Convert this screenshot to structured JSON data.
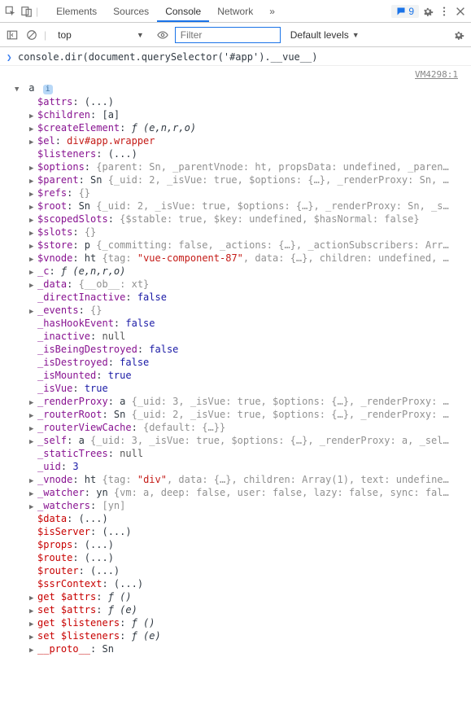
{
  "toolbar": {
    "tabs": [
      "Elements",
      "Sources",
      "Console",
      "Network"
    ],
    "active_tab": "Console",
    "more_tabs": "»",
    "message_count": "9"
  },
  "subbar": {
    "context": "top",
    "filter_placeholder": "Filter",
    "levels_label": "Default levels"
  },
  "command": {
    "text": "console.dir(document.querySelector('#app').__vue__)",
    "source": "VM4298:1"
  },
  "root_label": "a",
  "props": [
    {
      "arrow": "none",
      "key": "$attrs",
      "kc": "k-purple",
      "val": ": (...)"
    },
    {
      "arrow": "right",
      "key": "$children",
      "kc": "k-purple",
      "val": ": [a]"
    },
    {
      "arrow": "right",
      "key": "$createElement",
      "kc": "k-purple",
      "val_html": ": <span class='fn-i'>ƒ (e,n,r,o)</span>"
    },
    {
      "arrow": "right",
      "key": "$el",
      "kc": "k-purple",
      "val_html": ": <span class='v-str'>div#app.wrapper</span>"
    },
    {
      "arrow": "none",
      "key": "$listeners",
      "kc": "k-purple",
      "val": ": (...)"
    },
    {
      "arrow": "right",
      "key": "$options",
      "kc": "k-purple",
      "val_html": ": <span class='v-dim'>{parent: Sn, _parentVnode: ht, propsData: undefined, _paren…</span>"
    },
    {
      "arrow": "right",
      "key": "$parent",
      "kc": "k-purple",
      "val_html": ": Sn <span class='v-dim'>{_uid: 2, _isVue: true, $options: {…}, _renderProxy: Sn, …</span>"
    },
    {
      "arrow": "right",
      "key": "$refs",
      "kc": "k-purple",
      "val_html": ": <span class='v-dim'>{}</span>"
    },
    {
      "arrow": "right",
      "key": "$root",
      "kc": "k-purple",
      "val_html": ": Sn <span class='v-dim'>{_uid: 2, _isVue: true, $options: {…}, _renderProxy: Sn, _s…</span>"
    },
    {
      "arrow": "right",
      "key": "$scopedSlots",
      "kc": "k-purple",
      "val_html": ": <span class='v-dim'>{$stable: true, $key: undefined, $hasNormal: false}</span>"
    },
    {
      "arrow": "right",
      "key": "$slots",
      "kc": "k-purple",
      "val_html": ": <span class='v-dim'>{}</span>"
    },
    {
      "arrow": "right",
      "key": "$store",
      "kc": "k-purple",
      "val_html": ": p <span class='v-dim'>{_committing: false, _actions: {…}, _actionSubscribers: Arr…</span>"
    },
    {
      "arrow": "right",
      "key": "$vnode",
      "kc": "k-purple",
      "val_html": ": ht <span class='v-dim'>{tag: <span class='v-str'>\"vue-component-87\"</span>, data: {…}, children: undefined, …</span>"
    },
    {
      "arrow": "right",
      "key": "_c",
      "kc": "k-purple",
      "val_html": ": <span class='fn-i'>ƒ (e,n,r,o)</span>"
    },
    {
      "arrow": "right",
      "key": "_data",
      "kc": "k-purple",
      "val_html": ": <span class='v-dim'>{__ob__: xt}</span>"
    },
    {
      "arrow": "none",
      "key": "_directInactive",
      "kc": "k-purple",
      "val_html": ": <span class='v-blue'>false</span>"
    },
    {
      "arrow": "right",
      "key": "_events",
      "kc": "k-purple",
      "val_html": ": <span class='v-dim'>{}</span>"
    },
    {
      "arrow": "none",
      "key": "_hasHookEvent",
      "kc": "k-purple",
      "val_html": ": <span class='v-blue'>false</span>"
    },
    {
      "arrow": "none",
      "key": "_inactive",
      "kc": "k-purple",
      "val_html": ": <span class='v-gray'>null</span>"
    },
    {
      "arrow": "none",
      "key": "_isBeingDestroyed",
      "kc": "k-purple",
      "val_html": ": <span class='v-blue'>false</span>"
    },
    {
      "arrow": "none",
      "key": "_isDestroyed",
      "kc": "k-purple",
      "val_html": ": <span class='v-blue'>false</span>"
    },
    {
      "arrow": "none",
      "key": "_isMounted",
      "kc": "k-purple",
      "val_html": ": <span class='v-blue'>true</span>"
    },
    {
      "arrow": "none",
      "key": "_isVue",
      "kc": "k-purple",
      "val_html": ": <span class='v-blue'>true</span>"
    },
    {
      "arrow": "right",
      "key": "_renderProxy",
      "kc": "k-purple",
      "val_html": ": a <span class='v-dim'>{_uid: 3, _isVue: true, $options: {…}, _renderProxy: …</span>"
    },
    {
      "arrow": "right",
      "key": "_routerRoot",
      "kc": "k-purple",
      "val_html": ": Sn <span class='v-dim'>{_uid: 2, _isVue: true, $options: {…}, _renderProxy: …</span>"
    },
    {
      "arrow": "right",
      "key": "_routerViewCache",
      "kc": "k-purple",
      "val_html": ": <span class='v-dim'>{default: {…}}</span>"
    },
    {
      "arrow": "right",
      "key": "_self",
      "kc": "k-purple",
      "val_html": ": a <span class='v-dim'>{_uid: 3, _isVue: true, $options: {…}, _renderProxy: a, _sel…</span>"
    },
    {
      "arrow": "none",
      "key": "_staticTrees",
      "kc": "k-purple",
      "val_html": ": <span class='v-gray'>null</span>"
    },
    {
      "arrow": "none",
      "key": "_uid",
      "kc": "k-purple",
      "val_html": ": <span class='v-blue'>3</span>"
    },
    {
      "arrow": "right",
      "key": "_vnode",
      "kc": "k-purple",
      "val_html": ": ht <span class='v-dim'>{tag: <span class='v-str'>\"div\"</span>, data: {…}, children: Array(1), text: undefine…</span>"
    },
    {
      "arrow": "right",
      "key": "_watcher",
      "kc": "k-purple",
      "val_html": ": yn <span class='v-dim'>{vm: a, deep: false, user: false, lazy: false, sync: fal…</span>"
    },
    {
      "arrow": "right",
      "key": "_watchers",
      "kc": "k-purple",
      "val_html": ": <span class='v-dim'>[yn]</span>"
    },
    {
      "arrow": "none",
      "key": "$data",
      "kc": "k-red",
      "val": ": (...)"
    },
    {
      "arrow": "none",
      "key": "$isServer",
      "kc": "k-red",
      "val": ": (...)"
    },
    {
      "arrow": "none",
      "key": "$props",
      "kc": "k-red",
      "val": ": (...)"
    },
    {
      "arrow": "none",
      "key": "$route",
      "kc": "k-red",
      "val": ": (...)"
    },
    {
      "arrow": "none",
      "key": "$router",
      "kc": "k-red",
      "val": ": (...)"
    },
    {
      "arrow": "none",
      "key": "$ssrContext",
      "kc": "k-red",
      "val": ": (...)"
    },
    {
      "arrow": "right",
      "key": "get $attrs",
      "kc": "k-red",
      "val_html": ": <span class='fn-i'>ƒ ()</span>"
    },
    {
      "arrow": "right",
      "key": "set $attrs",
      "kc": "k-red",
      "val_html": ": <span class='fn-i'>ƒ (e)</span>"
    },
    {
      "arrow": "right",
      "key": "get $listeners",
      "kc": "k-red",
      "val_html": ": <span class='fn-i'>ƒ ()</span>"
    },
    {
      "arrow": "right",
      "key": "set $listeners",
      "kc": "k-red",
      "val_html": ": <span class='fn-i'>ƒ (e)</span>"
    },
    {
      "arrow": "right",
      "key": "__proto__",
      "kc": "k-red",
      "val": ": Sn"
    }
  ]
}
